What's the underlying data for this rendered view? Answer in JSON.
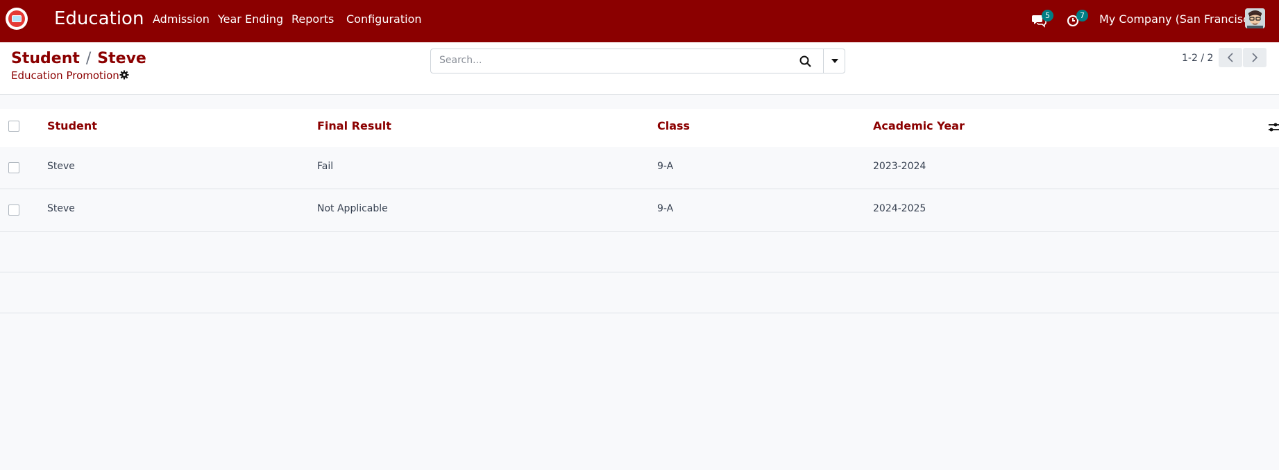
{
  "navbar": {
    "brand": "Education",
    "menu": [
      "Admission",
      "Year Ending",
      "Reports",
      "Configuration"
    ],
    "messages_count": "5",
    "activities_count": "7",
    "company": "My Company (San Francisco)"
  },
  "control": {
    "breadcrumb_parent": "Student",
    "breadcrumb_sep": "/",
    "breadcrumb_current": "Steve",
    "subtitle": "Education Promotion",
    "search_placeholder": "Search...",
    "pager": "1-2 / 2"
  },
  "table": {
    "columns": [
      "Student",
      "Final Result",
      "Class",
      "Academic Year"
    ],
    "rows": [
      {
        "student": "Steve",
        "final_result": "Fail",
        "class": "9-A",
        "academic_year": "2023-2024"
      },
      {
        "student": "Steve",
        "final_result": "Not Applicable",
        "class": "9-A",
        "academic_year": "2024-2025"
      }
    ]
  },
  "colors": {
    "brand": "#8b0000",
    "badge": "#017e84"
  }
}
